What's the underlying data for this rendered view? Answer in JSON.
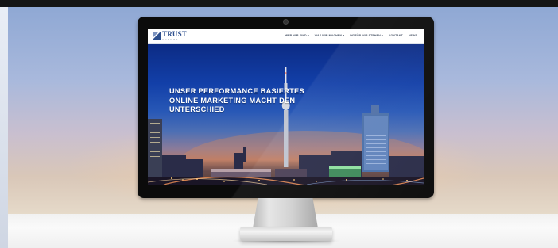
{
  "brand": {
    "name": "TRUST",
    "tagline": "AGENTS",
    "accent": "#2d4f8e"
  },
  "nav": {
    "items": [
      {
        "label": "WER WIR SIND ▾"
      },
      {
        "label": "WAS WIR MACHEN ▾"
      },
      {
        "label": "WOFÜR WIR STEHEN ▾"
      },
      {
        "label": "KONTAKT"
      },
      {
        "label": "NEWS"
      }
    ]
  },
  "hero": {
    "headline_lines": [
      "UNSER PERFORMANCE BASIERTES",
      "ONLINE MARKETING MACHT DEN",
      "UNTERSCHIED"
    ]
  },
  "icons": [
    "logo-mark-icon",
    "camera-icon"
  ]
}
